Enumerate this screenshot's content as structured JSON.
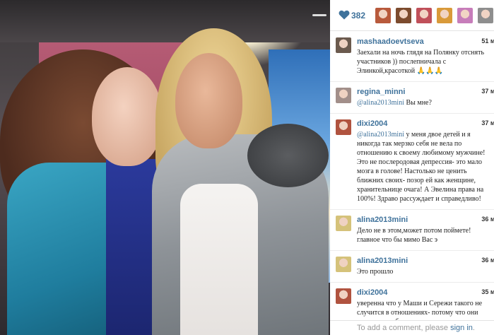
{
  "likes": {
    "count": "382",
    "avatar_colors": [
      "#b85a3c",
      "#7c4b2e",
      "#c0505a",
      "#d99a3a",
      "#c77dba",
      "#8e8e8e"
    ]
  },
  "comments": [
    {
      "user": "mashaadoevtseva",
      "time": "51 м.",
      "mention": "",
      "text": "Заехали на ночь глядя на Полянку отснять участников )) послепничала с Элинкой,красоткой 🙏🙏🙏",
      "avatar_color": "#6b5a4e"
    },
    {
      "user": "regina_minni",
      "time": "37 м.",
      "mention": "@alina2013mini",
      "text": " Вы мне?",
      "avatar_color": "#a28f8a"
    },
    {
      "user": "dixi2004",
      "time": "37 м.",
      "mention": "@alina2013mini",
      "text": " у меня двое детей и я никогда так мерзко себя не вела по отношению к своему любимому мужчине! Это не послеродовая депрессия- это мало мозга в голове! Настолько не ценить ближних своих- позор ей как женщине, хранительнице очага! А Эвелина права на 100%! Здраво рассуждает и справедливо!",
      "avatar_color": "#b0533f"
    },
    {
      "user": "alina2013mini",
      "time": "36 м.",
      "mention": "",
      "text": "Дело не в этом,может потом поймете! главное что бы мимо Вас э",
      "avatar_color": "#d5c27a"
    },
    {
      "user": "alina2013mini",
      "time": "36 м.",
      "mention": "",
      "text": "Это прошло",
      "avatar_color": "#d5c27a"
    },
    {
      "user": "dixi2004",
      "time": "35 м.",
      "mention": "",
      "text": "уверенна что у Маши и Сережи такого не случится в отношениях- потому что они искренне любят друг друга и дорожат тем что есть у каждого!",
      "avatar_color": "#b0533f"
    }
  ],
  "footer": {
    "prefix": "To add a comment, please ",
    "link": "sign in",
    "suffix": "."
  },
  "colors": {
    "link": "#3f729b",
    "heart": "#3f729b"
  }
}
